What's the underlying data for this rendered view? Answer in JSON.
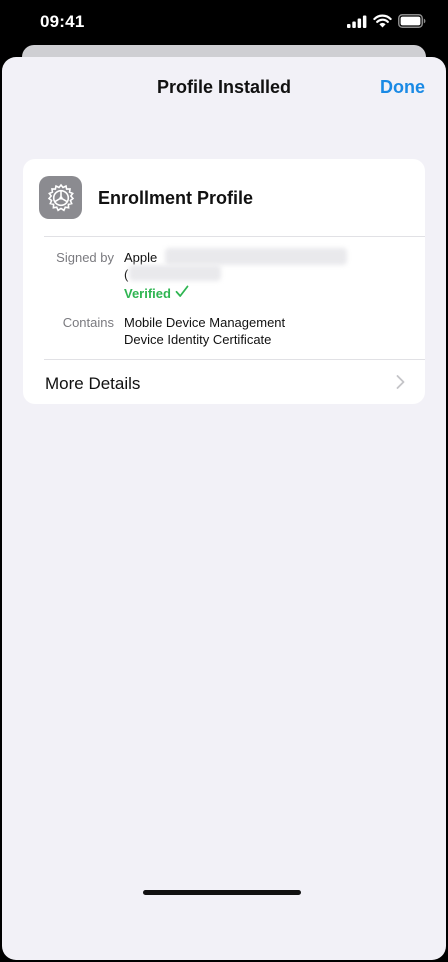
{
  "status_bar": {
    "time": "09:41"
  },
  "nav": {
    "title": "Profile Installed",
    "done_label": "Done"
  },
  "profile": {
    "name": "Enrollment Profile",
    "icon": "gear-icon",
    "signed_by_label": "Signed by",
    "signed_by_value": "Apple",
    "signed_by_paren": "(",
    "verified_label": "Verified",
    "contains_label": "Contains",
    "contains_items": [
      "Mobile Device Management",
      "Device Identity Certificate"
    ]
  },
  "more_details": {
    "label": "More Details"
  },
  "colors": {
    "accent": "#1a8ae5",
    "verified": "#2fb552",
    "sheet_bg": "#f2f1f7"
  }
}
